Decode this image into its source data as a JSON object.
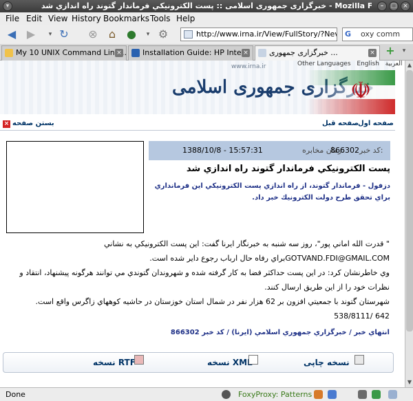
{
  "window": {
    "title": "خبرگزاری جمهوری اسلامی :: پست الكترونيكي فرماندار گتوند راه اندازي شد - Mozilla Firefox"
  },
  "menu": [
    "File",
    "Edit",
    "View",
    "History",
    "Bookmarks",
    "Tools",
    "Help"
  ],
  "navbar": {
    "url": "http://www.irna.ir/View/FullStory/?Nev",
    "search_value": "oxy comm"
  },
  "tabs": [
    {
      "label": "My 10 UNIX Command Line..."
    },
    {
      "label": "Installation Guide: HP Inte..."
    },
    {
      "label": "خبرگزاری جمهوری ..."
    }
  ],
  "banner": {
    "site_url": "www.irna.ir",
    "other_languages": "Other Languages",
    "english": "English",
    "arabic": "العربية",
    "logo_text": "خبرگزاری جمهوری اسلامی"
  },
  "toplinks": {
    "close_page": "بستن صفحه",
    "prev_page": "صفحه قبل",
    "first_page": "صفحه اول"
  },
  "news": {
    "code_label": "كد خبر:",
    "code": "866302",
    "time_label": "زمان مخابره:",
    "time": "1388/10/8 - 15:57:31",
    "headline": "پست الكترونيكي فرماندار گتوند راه اندازي شد",
    "lead": "دزفول - فرماندار گتوند، از راه اندازي پست الكترونيكي اين فرمانداري براي تحقق طرح دولت الكترونيك خبر داد.",
    "paragraphs": [
      "\" قدرت الله اماني پور\"، روز سه شنبه به خبرنگار ايرنا گفت: اين پست الكترونيكي به نشاني GOTVAND.FDI@GMAIL.COMبراي رفاه حال ارباب رجوع داير شده است.",
      "وي خاطرنشان كرد: در اين پست حداكثر فضا به كار گرفته شده و شهروندان گتوندي مي توانند هرگونه پيشنهاد، انتقاد و نظرات خود را از اين طريق ارسال كنند.",
      "شهرستان گتوند با جمعيتي افزون بر 62 هزار نفر در شمال استان خوزستان در حاشيه كوههاي زاگرس واقع است.",
      "642 /538/8111"
    ],
    "source": "انتهاي خبر / خبرگزاري جمهوري اسلامي (ايرنا) / كد خبر 866302"
  },
  "actions": {
    "print": "نسخه چاپی",
    "xml": "نسخه XML",
    "rtf": "نسخه RTF"
  },
  "status": {
    "text": "Done",
    "foxyproxy": "FoxyProxy: Patterns"
  }
}
